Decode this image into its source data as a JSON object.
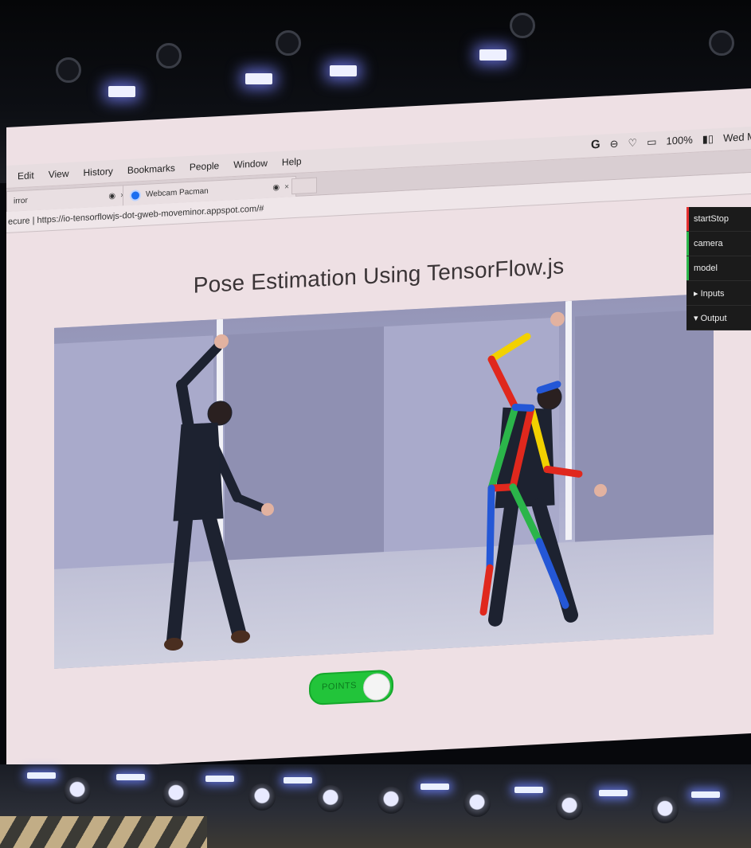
{
  "system": {
    "status_g": "G",
    "battery": "100%",
    "clock": "Wed M"
  },
  "menubar": {
    "items": [
      "Edit",
      "View",
      "History",
      "Bookmarks",
      "People",
      "Window",
      "Help"
    ]
  },
  "tabs": [
    {
      "label": "irror",
      "close": "×"
    },
    {
      "label": "Webcam Pacman",
      "close": "×"
    }
  ],
  "address": {
    "text": "ecure | https://io-tensorflowjs-dot-gweb-moveminor.appspot.com/#"
  },
  "page": {
    "title": "Pose Estimation Using TensorFlow.js",
    "toggle_label": "POINTS"
  },
  "gui": {
    "rows": [
      {
        "label": "startStop",
        "color": "#e53030"
      },
      {
        "label": "camera",
        "color": "#2db84d"
      },
      {
        "label": "model",
        "color": "#2db84d"
      },
      {
        "label": "▸ Inputs",
        "color": ""
      },
      {
        "label": "▾ Output",
        "color": ""
      }
    ]
  },
  "skeleton_colors": {
    "yellow": "#f2d100",
    "red": "#e0281d",
    "green": "#2bb54a",
    "blue": "#2457d6"
  }
}
